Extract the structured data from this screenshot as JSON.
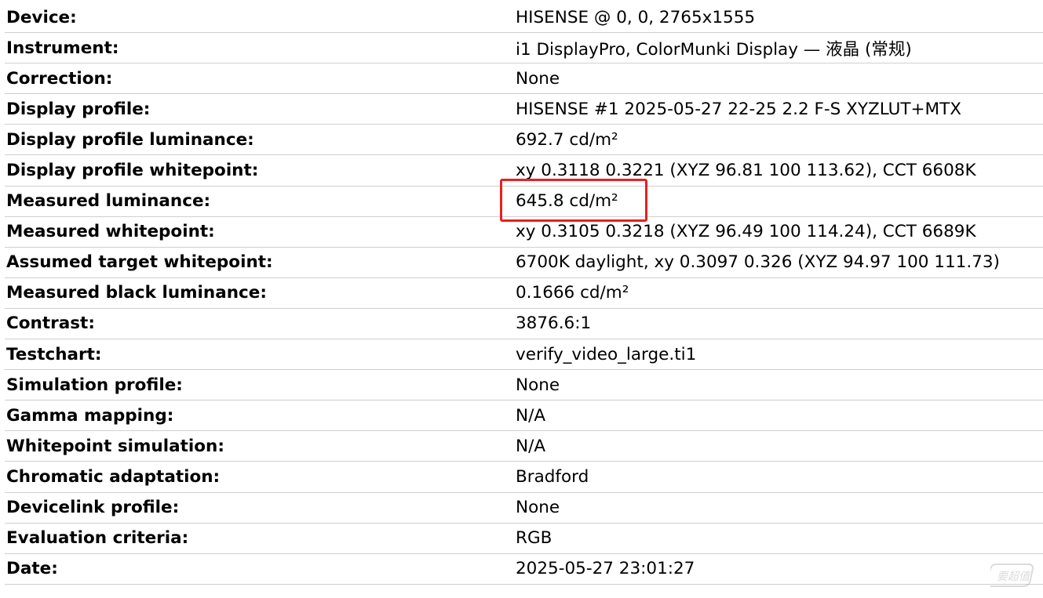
{
  "report": {
    "rows": [
      {
        "label": "Device:",
        "value": "HISENSE @ 0, 0, 2765x1555"
      },
      {
        "label": "Instrument:",
        "value": "i1 DisplayPro, ColorMunki Display — 液晶 (常规)"
      },
      {
        "label": "Correction:",
        "value": "None"
      },
      {
        "label": "Display profile:",
        "value": "HISENSE #1 2025-05-27 22-25 2.2 F-S XYZLUT+MTX"
      },
      {
        "label": "Display profile luminance:",
        "value": "692.7 cd/m²"
      },
      {
        "label": "Display profile whitepoint:",
        "value": "xy 0.3118 0.3221 (XYZ 96.81 100 113.62), CCT 6608K"
      },
      {
        "label": "Measured luminance:",
        "value": "645.8 cd/m²"
      },
      {
        "label": "Measured whitepoint:",
        "value": "xy 0.3105 0.3218 (XYZ 96.49 100 114.24), CCT 6689K"
      },
      {
        "label": "Assumed target whitepoint:",
        "value": "6700K daylight, xy 0.3097 0.326 (XYZ 94.97 100 111.73)"
      },
      {
        "label": "Measured black luminance:",
        "value": "0.1666 cd/m²"
      },
      {
        "label": "Contrast:",
        "value": "3876.6:1"
      },
      {
        "label": "Testchart:",
        "value": "verify_video_large.ti1"
      },
      {
        "label": "Simulation profile:",
        "value": "None"
      },
      {
        "label": "Gamma mapping:",
        "value": "N/A"
      },
      {
        "label": "Whitepoint simulation:",
        "value": "N/A"
      },
      {
        "label": "Chromatic adaptation:",
        "value": "Bradford"
      },
      {
        "label": "Devicelink profile:",
        "value": "None"
      },
      {
        "label": "Evaluation criteria:",
        "value": "RGB"
      },
      {
        "label": "Date:",
        "value": "2025-05-27 23:01:27"
      }
    ]
  },
  "highlight": {
    "target_row": "Measured luminance:",
    "color": "#e8201f"
  },
  "watermark": {
    "text": "要超值",
    "icon": "watermark-logo-icon"
  },
  "colors": {
    "row_divider": "#cfcfcf",
    "text": "#000000",
    "background": "#ffffff"
  }
}
